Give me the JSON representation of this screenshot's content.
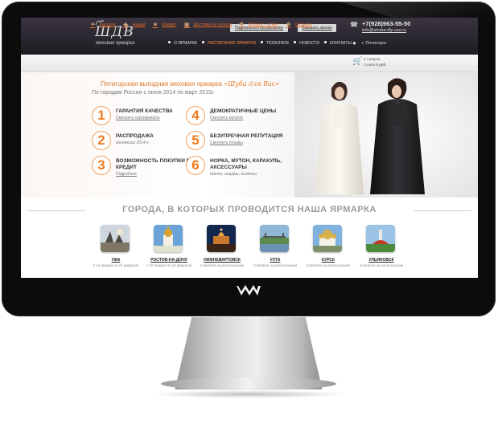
{
  "site": {
    "brand": "ШДВ",
    "tagline": "меховая ярмарка",
    "top_buttons": {
      "subscribe": "Подписаться на рассылку",
      "call": "Заказать звонок"
    },
    "phone": "+7(928)963-55-50",
    "email": "info@shuba-dly-vas.ru",
    "city": "г. Пятигорск"
  },
  "nav": [
    {
      "label": "О ЯРМАРКЕ",
      "active": false
    },
    {
      "label": "РАСПИСАНИЕ ЯРМАРОК",
      "active": true
    },
    {
      "label": "ПОЛЕЗНОЕ",
      "active": false
    },
    {
      "label": "НОВОСТИ",
      "active": false
    },
    {
      "label": "КОНТАКТЫ",
      "active": false
    }
  ],
  "menu": [
    {
      "label": "Каталог",
      "icon": "coat-icon"
    },
    {
      "label": "Акции",
      "icon": "tag-icon"
    },
    {
      "label": "Кредит",
      "icon": "star-icon"
    },
    {
      "label": "Доставка и оплата",
      "icon": "box-icon"
    },
    {
      "label": "Вопрос - ответ",
      "icon": "chat-icon"
    },
    {
      "label": "Отзывы",
      "icon": "reviews-icon"
    }
  ],
  "cart": {
    "count": "0 товаров",
    "sum_label": "Сумма",
    "sum": "0 руб."
  },
  "hero": {
    "title_prefix": "Пятигорская выездная меховая ярмарка",
    "title_brand": "«Шуба для Вас»",
    "subtitle": "По городам России с июня 2014 по март 2015г."
  },
  "features": [
    {
      "num": "1",
      "title": "ГАРАНТИЯ КАЧЕСТВА",
      "link": "Смотреть сертификаты",
      "sub": ""
    },
    {
      "num": "2",
      "title": "РАСПРОДАЖА",
      "link": "",
      "sub": "коллекций 2014 г."
    },
    {
      "num": "3",
      "title": "ВОЗМОЖНОСТЬ ПОКУПКИ В КРЕДИТ",
      "link": "Подробнее",
      "sub": ""
    },
    {
      "num": "4",
      "title": "ДЕМОКРАТИЧНЫЕ ЦЕНЫ",
      "link": "Смотреть каталог",
      "sub": ""
    },
    {
      "num": "5",
      "title": "БЕЗУПРЕЧНАЯ РЕПУТАЦИЯ",
      "link": "Смотреть отзывы",
      "sub": ""
    },
    {
      "num": "6",
      "title": "НОРКА, МУТОН, КАРАКУЛЬ, АКСЕССУАРЫ",
      "link": "",
      "sub": "Шапки, шарфы, жилеты"
    }
  ],
  "cities_title": "ГОРОДА, В КОТОРЫХ ПРОВОДИТСЯ НАША ЯРМАРКА",
  "cities": [
    {
      "name": "УФА",
      "date": "с 14 января по 15 февраля"
    },
    {
      "name": "РОСТОВ-НА-ДОНУ",
      "date": "с 20 января по 15 февраля"
    },
    {
      "name": "НИЖНЕВАРТОВСК",
      "date": "Следите за расписанием"
    },
    {
      "name": "УХТА",
      "date": "Следите за расписанием"
    },
    {
      "name": "КУРСК",
      "date": "Следите за расписанием"
    },
    {
      "name": "УЛЬЯНОВСК",
      "date": "Следите за расписанием"
    }
  ],
  "colors": {
    "accent": "#e07a2c",
    "topbar": "#2a2630",
    "screen_bezel": "#0c0c0d"
  }
}
